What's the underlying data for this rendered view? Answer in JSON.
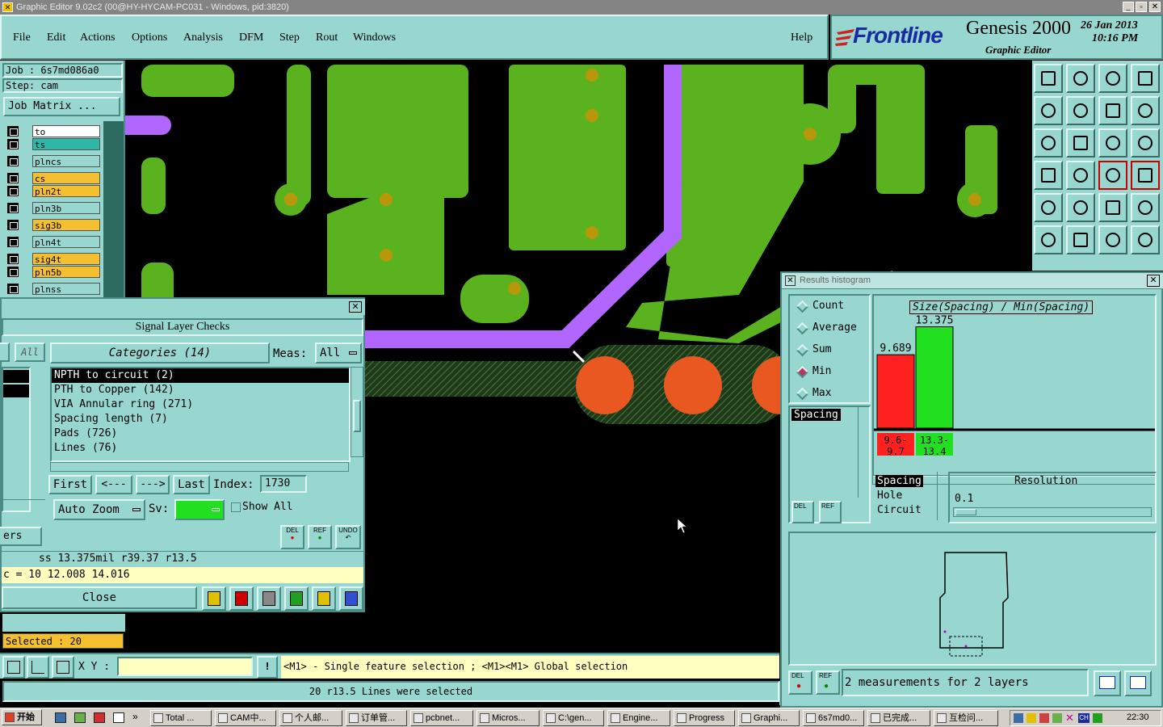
{
  "titlebar": {
    "text": "Graphic Editor 9.02c2 (00@HY-HYCAM-PC031 - Windows, pid:3820)"
  },
  "menu": {
    "items": [
      "File",
      "Edit",
      "Actions",
      "Options",
      "Analysis",
      "DFM",
      "Step",
      "Rout",
      "Windows"
    ],
    "help": "Help"
  },
  "brand": {
    "logo": "Frontline",
    "product": "Genesis 2000",
    "subtitle": "Graphic Editor",
    "date": "26 Jan 2013",
    "time": "10:16 PM"
  },
  "job": {
    "job_label": "Job : 6s7md086a0",
    "step_label": "Step: cam",
    "matrix_button": "Job Matrix ..."
  },
  "layers": [
    {
      "name": "to",
      "color": "#ffffff"
    },
    {
      "name": "ts",
      "color": "#2fb8a8"
    },
    {
      "name": "plncs",
      "color": "#97d7d0"
    },
    {
      "name": "cs",
      "color": "#f5c030"
    },
    {
      "name": "pln2t",
      "color": "#f5c030"
    },
    {
      "name": "pln3b",
      "color": "#97d7d0"
    },
    {
      "name": "sig3b",
      "color": "#f5c030"
    },
    {
      "name": "pln4t",
      "color": "#97d7d0"
    },
    {
      "name": "sig4t",
      "color": "#f5c030"
    },
    {
      "name": "pln5b",
      "color": "#f5c030"
    },
    {
      "name": "plnss",
      "color": "#97d7d0"
    }
  ],
  "checks": {
    "title": "Signal Layer Checks",
    "all_label": "All",
    "categories_label": "Categories (14)",
    "meas_label": "Meas:",
    "meas_value": "All",
    "items": [
      "NPTH to circuit (2)",
      "PTH to Copper (142)",
      "VIA Annular ring (271)",
      "Spacing length (7)",
      "Pads (726)",
      "Lines (76)"
    ],
    "nav": {
      "first": "First",
      "prev": "<---",
      "next": "--->",
      "last": "Last",
      "index_label": "Index:",
      "index_value": "1730"
    },
    "auto_zoom": "Auto Zoom",
    "sv_label": "Sv:",
    "show_all": "Show All",
    "del": "DEL",
    "ref": "REF",
    "undo": "UNDO",
    "ers": "ers",
    "info1": "ss 13.375mil  r39.37  r13.5",
    "info2": "c = 10 12.008 14.016",
    "close": "Close"
  },
  "selected": "Selected : 20",
  "coords": {
    "label": "X Y :",
    "value": ""
  },
  "status": {
    "hint": "<M1> - Single feature selection ; <M1><M1> Global selection",
    "message": "20 r13.5 Lines were selected"
  },
  "histogram": {
    "window_title": "Results histogram",
    "modes": [
      "Count",
      "Average",
      "Sum",
      "Min",
      "Max"
    ],
    "selected_mode": "Min",
    "chart_title": "Size(Spacing) / Min(Spacing)",
    "types": [
      "Spacing"
    ],
    "groups": [
      "Spacing",
      "Hole",
      "Circuit"
    ],
    "resolution_label": "Resolution",
    "resolution_value": "0.1",
    "footer": "2 measurements for 2 layers",
    "del": "DEL",
    "ref": "REF"
  },
  "chart_data": {
    "type": "bar",
    "title": "Size(Spacing) / Min(Spacing)",
    "categories": [
      "9.6-9.7",
      "13.3-13.4"
    ],
    "values": [
      9.689,
      13.375
    ],
    "colors": [
      "#ff2020",
      "#20e020"
    ],
    "ylim": [
      0,
      14.5
    ]
  },
  "taskbar": {
    "start": "开始",
    "tasks": [
      "Total ...",
      "CAM中...",
      "个人邮...",
      "订单管...",
      "pcbnet...",
      "Micros...",
      "C:\\gen...",
      "Engine...",
      "Progress",
      "Graphi...",
      "6s7md0...",
      "已完成...",
      "互检问..."
    ],
    "clock": "22:30"
  }
}
